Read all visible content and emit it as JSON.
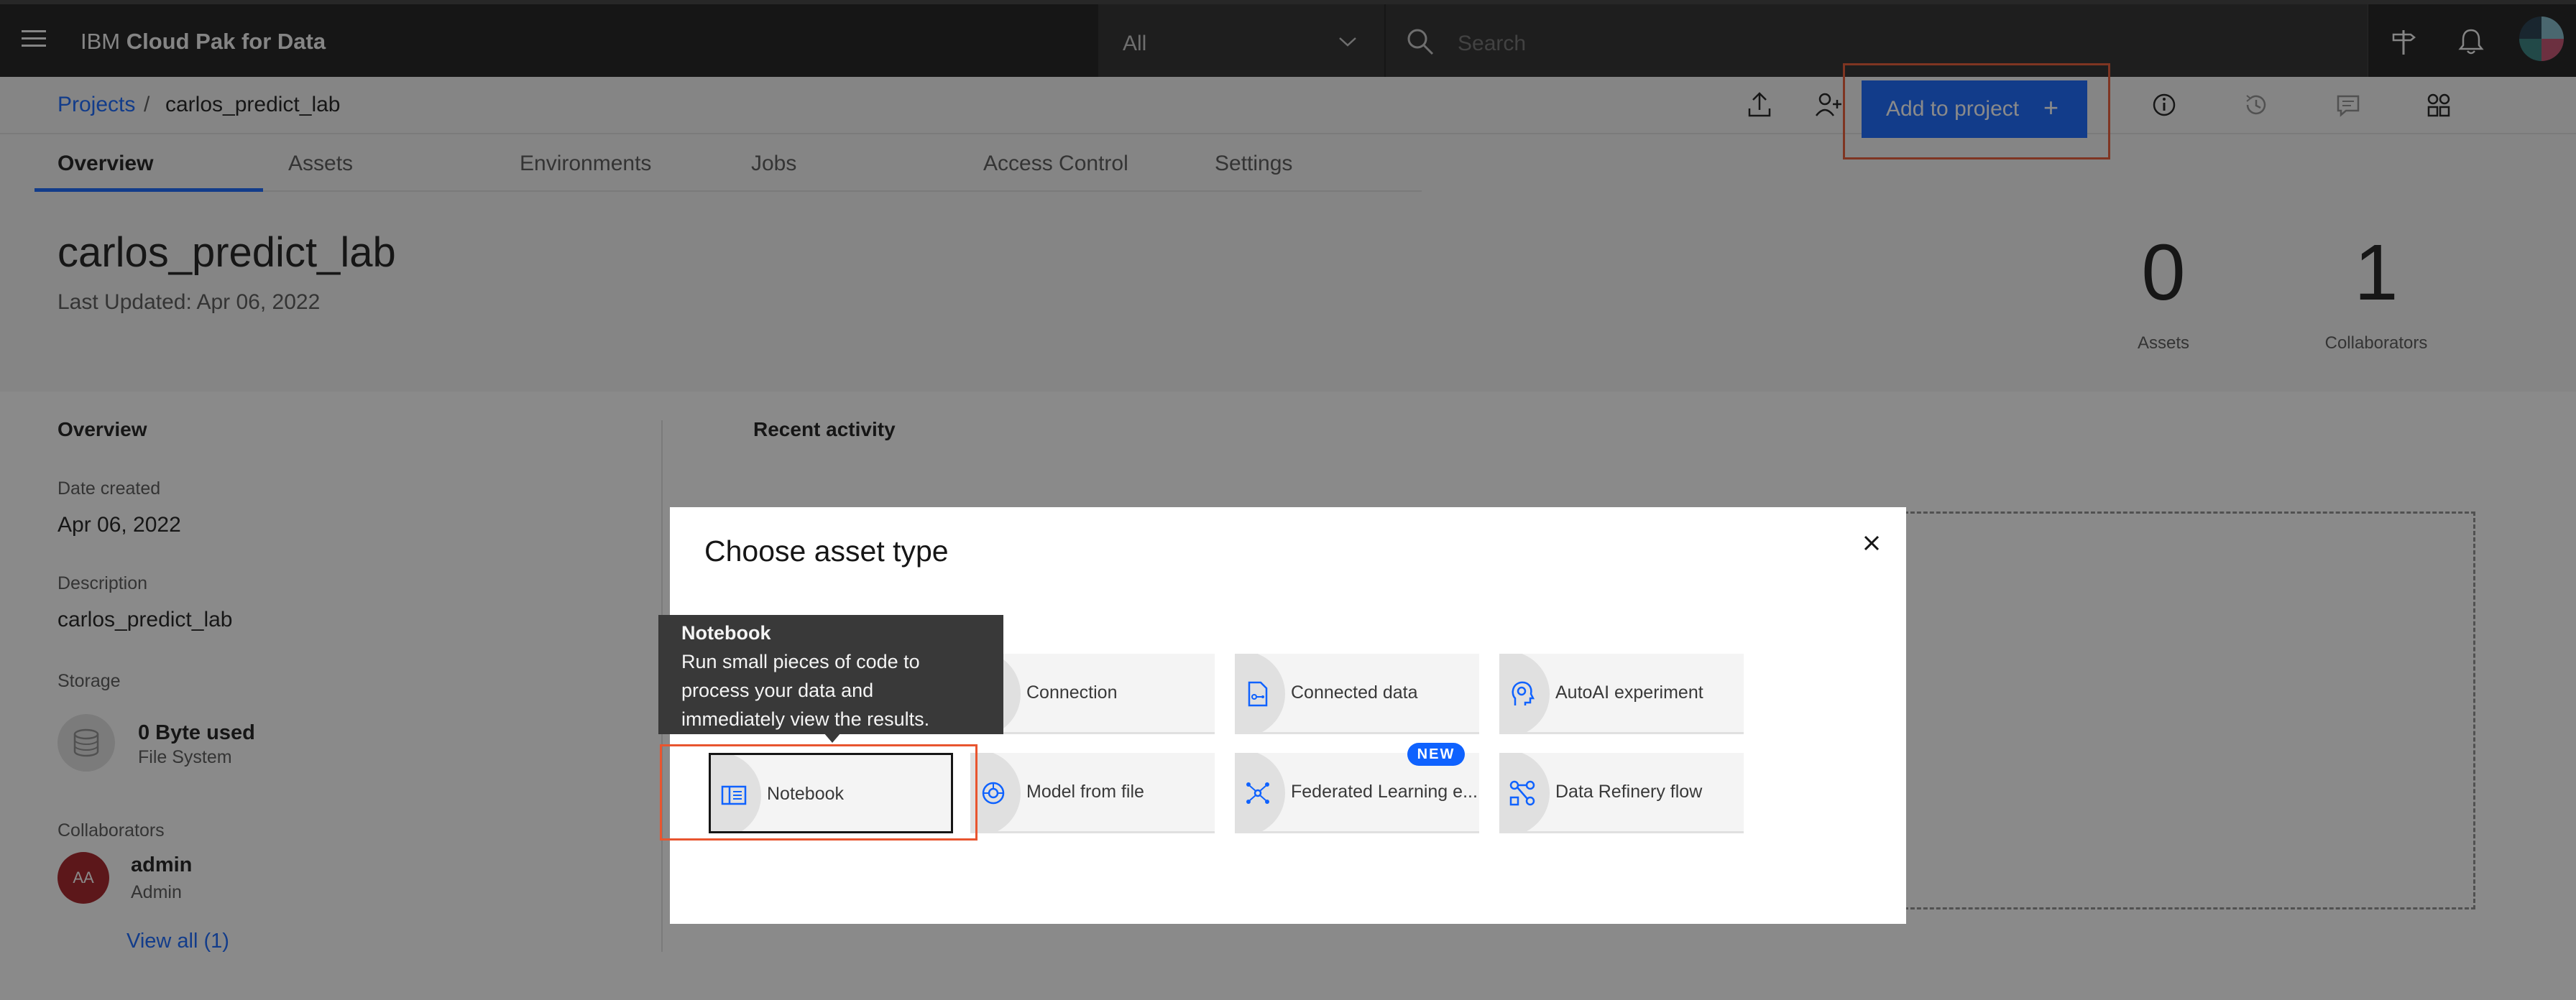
{
  "header": {
    "brand_prefix": "IBM",
    "brand_name": "Cloud Pak for Data",
    "scope_value": "All",
    "search_placeholder": "Search"
  },
  "breadcrumb": {
    "parent": "Projects",
    "separator": "/",
    "current": "carlos_predict_lab"
  },
  "toolbar": {
    "add_label": "Add to project",
    "add_plus": "+"
  },
  "tabs": [
    {
      "label": "Overview"
    },
    {
      "label": "Assets"
    },
    {
      "label": "Environments"
    },
    {
      "label": "Jobs"
    },
    {
      "label": "Access Control"
    },
    {
      "label": "Settings"
    }
  ],
  "project": {
    "title": "carlos_predict_lab",
    "updated": "Last Updated: Apr 06, 2022",
    "assets_count": "0",
    "assets_label": "Assets",
    "collab_count": "1",
    "collab_label": "Collaborators"
  },
  "overview": {
    "heading": "Overview",
    "date_label": "Date created",
    "date_value": "Apr 06, 2022",
    "desc_label": "Description",
    "desc_value": "carlos_predict_lab",
    "storage_label": "Storage",
    "storage_used": "0 Byte used",
    "storage_type": "File System",
    "collab_label": "Collaborators",
    "collab_initials": "AA",
    "collab_name": "admin",
    "collab_role": "Admin",
    "view_all": "View all (1)"
  },
  "activity": {
    "heading": "Recent activity"
  },
  "modal": {
    "title": "Choose asset type",
    "tiles": [
      {
        "label": "Connection",
        "icon": "connection-icon"
      },
      {
        "label": "Connected data",
        "icon": "connected-data-icon"
      },
      {
        "label": "AutoAI experiment",
        "icon": "autoai-icon"
      },
      {
        "label": "Notebook",
        "icon": "notebook-icon"
      },
      {
        "label": "Model from file",
        "icon": "model-icon"
      },
      {
        "label": "Federated Learning e...",
        "icon": "federated-learning-icon"
      },
      {
        "label": "Data Refinery flow",
        "icon": "data-refinery-icon"
      }
    ],
    "new_badge": "NEW",
    "tooltip": {
      "title": "Notebook",
      "description": "Run small pieces of code to process your data and immediately view the results."
    }
  },
  "colors": {
    "accent": "#0f62fe",
    "highlight": "#e8552f",
    "header_bg": "#161616",
    "avatar": "#a2191f"
  }
}
